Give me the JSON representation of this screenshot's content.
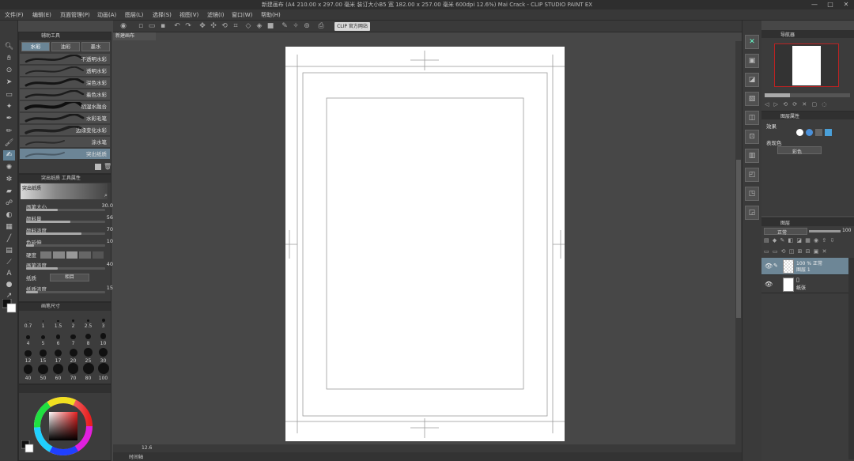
{
  "window": {
    "title": "新建画布 (A4 210.00 x 297.00 毫米 装订大小B5 宽 182.00 x 257.00 毫米 600dpi 12.6%)   Mai Crack - CLIP STUDIO PAINT EX"
  },
  "menu": [
    "文件(F)",
    "编辑(E)",
    "页面管理(P)",
    "动画(A)",
    "图层(L)",
    "选择(S)",
    "视图(V)",
    "滤镜(I)",
    "窗口(W)",
    "帮助(H)"
  ],
  "command_bar": {
    "clip_button": "CLIP 官方网站"
  },
  "doc_tab": "新建画布",
  "subtool": {
    "title": "辅助工具",
    "tabs": [
      "水彩",
      "油彩",
      "墨水"
    ],
    "brushes": [
      "不透明水彩",
      "透明水彩",
      "深色水彩",
      "着色水彩",
      "稍湿水融合",
      "水彩毛笔",
      "边缘变化水彩",
      "涂水笔",
      "突出纸质"
    ]
  },
  "toolprop": {
    "title": "突出纸质 工具属性",
    "preset": "突出纸质",
    "props": [
      {
        "label": "画笔大小",
        "value": "30.0",
        "fill": 0.4
      },
      {
        "label": "颜料量",
        "value": "56",
        "fill": 0.56
      },
      {
        "label": "颜料浓度",
        "value": "70",
        "fill": 0.7
      },
      {
        "label": "色延伸",
        "value": "10",
        "fill": 0.1
      }
    ],
    "hardness_label": "硬度",
    "brush_density_label": "画笔浓度",
    "brush_density_value": "40",
    "paper_label": "纸质",
    "paper_value": "相目",
    "paper_density_label": "纸质浓度",
    "paper_density_value": "15"
  },
  "brushsize": {
    "title": "画笔尺寸",
    "sizes": [
      "0.7",
      "1",
      "1.5",
      "2",
      "2.5",
      "3",
      "4",
      "5",
      "6",
      "7",
      "8",
      "10",
      "12",
      "15",
      "17",
      "20",
      "25",
      "30",
      "40",
      "50",
      "60",
      "70",
      "80",
      "100"
    ]
  },
  "navigator": {
    "title": "导航器"
  },
  "color_panel": {
    "title": "图层属性",
    "effect_label": "效果",
    "expression_label": "表现色",
    "expression_value": "彩色"
  },
  "layers": {
    "title": "图层",
    "blend_mode": "正常",
    "opacity": "100",
    "items": [
      {
        "percent_mode": "100 % 正常",
        "name": "图层 1"
      },
      {
        "percent_mode": "",
        "name": "纸张"
      }
    ]
  },
  "bottom": {
    "zoom": "12.6",
    "tab": "时间轴"
  },
  "colors": {
    "accent": "#6c8596",
    "bg": "#474747"
  }
}
